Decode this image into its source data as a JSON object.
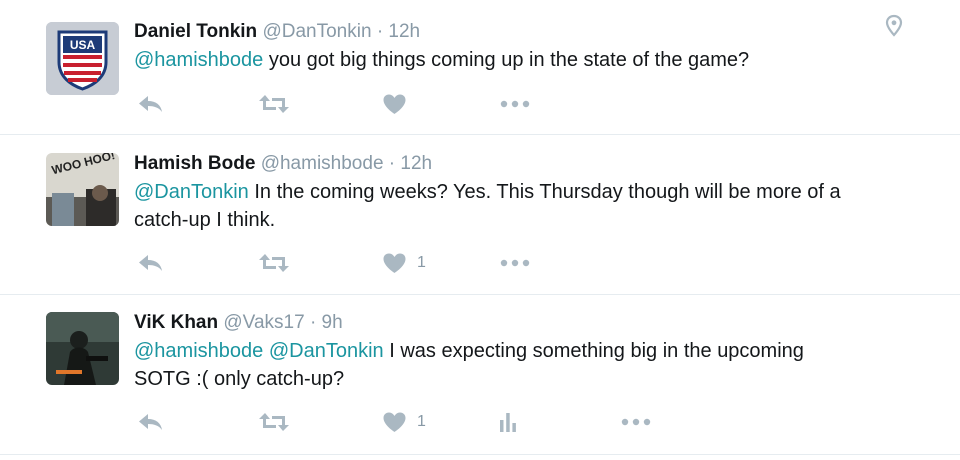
{
  "tweets": [
    {
      "name": "Daniel Tonkin",
      "handle": "@DanTonkin",
      "sep": "·",
      "time": "12h",
      "avatar_label": "USA",
      "mentions": [
        "@hamishbode"
      ],
      "text": "you got big things coming up in the state of the game?",
      "like_count": "",
      "icons": [
        "reply-icon",
        "retweet-icon",
        "heart-icon",
        "more-icon"
      ]
    },
    {
      "name": "Hamish Bode",
      "handle": "@hamishbode",
      "sep": "·",
      "time": "12h",
      "avatar_label": "WOO HOO!",
      "mentions": [
        "@DanTonkin"
      ],
      "text_line1": "In the coming weeks? Yes. This Thursday though will be more of a",
      "text_line2": "catch-up I think.",
      "like_count": "1",
      "icons": [
        "reply-icon",
        "retweet-icon",
        "heart-icon",
        "more-icon"
      ]
    },
    {
      "name": "ViK Khan",
      "handle": "@Vaks17",
      "sep": "·",
      "time": "9h",
      "mentions": [
        "@hamishbode",
        "@DanTonkin"
      ],
      "text_line1": "I was expecting something big in the upcoming",
      "text_line2": "SOTG :( only catch-up?",
      "like_count": "1",
      "icons": [
        "reply-icon",
        "retweet-icon",
        "heart-icon",
        "analytics-icon",
        "more-icon"
      ]
    }
  ],
  "colors": {
    "mention": "#1b95a0",
    "meta": "#8899a6",
    "icon": "#aab8c2",
    "divider": "#e6ecf0"
  }
}
